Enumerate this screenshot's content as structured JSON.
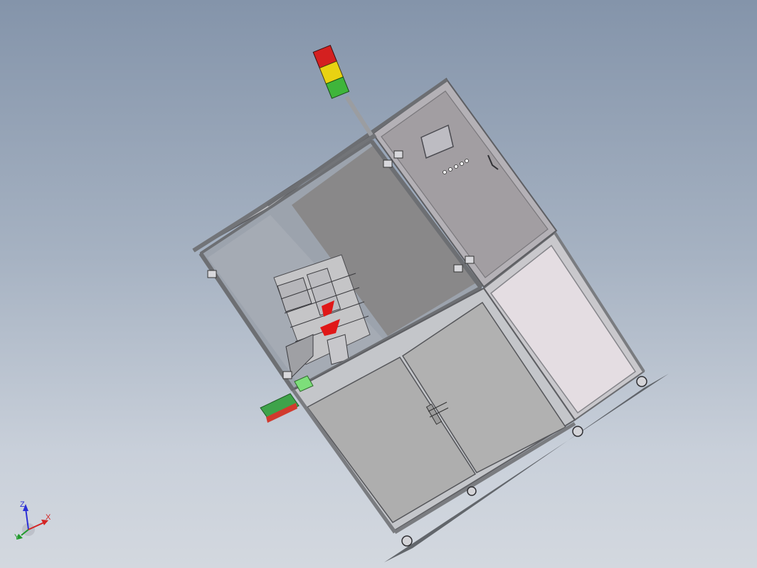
{
  "viewport": {
    "background_top": "#8494aa",
    "background_bottom": "#d3d8df"
  },
  "machine": {
    "frame_color": "#b9bcc1",
    "door_color": "#aeaeae",
    "side_panel_color": "#e4dde2",
    "control_panel_color": "#a29ea2",
    "window_tint": "#8a8a8a",
    "signal_tower": {
      "lights": [
        "red",
        "yellow",
        "green"
      ],
      "colors": [
        "#d42020",
        "#e8d212",
        "#3fb53b"
      ]
    },
    "accent_parts_color": "#e01818",
    "tray_color": "#3ea34a"
  },
  "triad": {
    "x_label": "X",
    "y_label": "Y",
    "z_label": "Z",
    "x_color": "#d42424",
    "y_color": "#1f9a2a",
    "z_color": "#2b2fd6"
  }
}
